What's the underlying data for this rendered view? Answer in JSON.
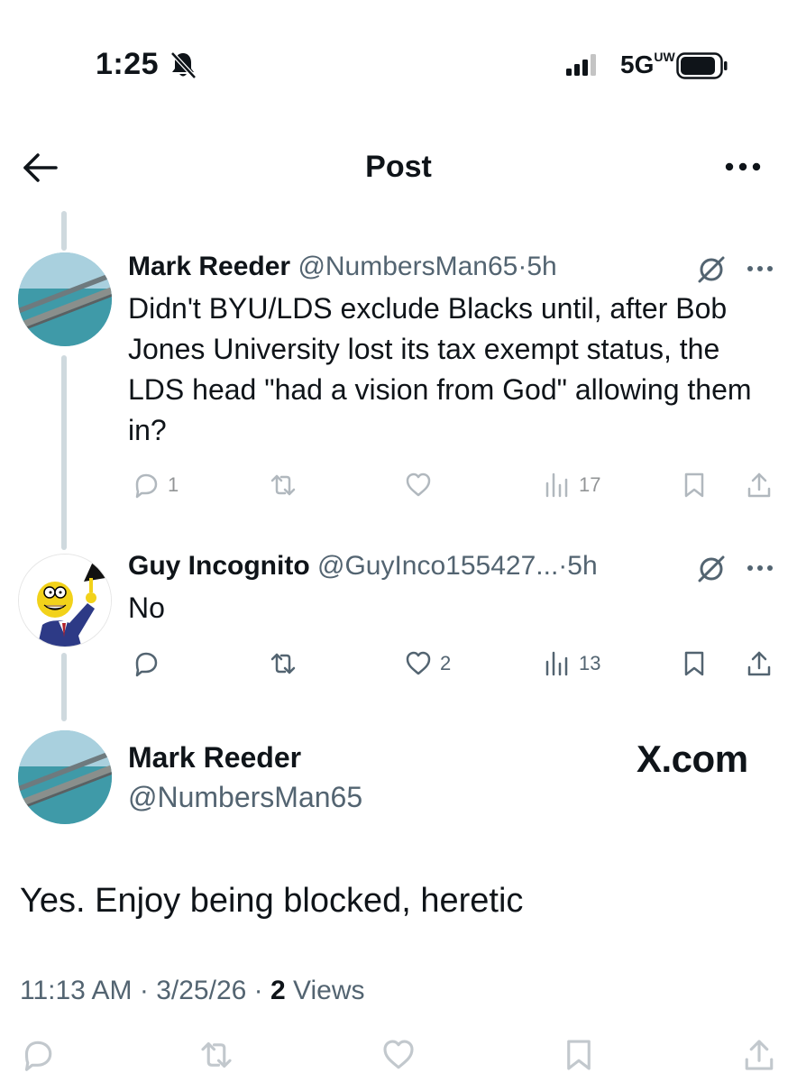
{
  "status_bar": {
    "time": "1:25",
    "network": "5G",
    "network_sup": "UW"
  },
  "nav": {
    "title": "Post"
  },
  "thread": [
    {
      "name": "Mark Reeder",
      "handle": "@NumbersMan65",
      "separator": "·",
      "time": "5h",
      "text": "Didn't BYU/LDS exclude Blacks until, after Bob Jones University lost its tax exempt status, the LDS head \"had a vision from God\" allowing them in?",
      "replies": "1",
      "likes": "",
      "views": "17"
    },
    {
      "name": "Guy Incognito",
      "handle": "@GuyInco155427...",
      "separator": "·",
      "time": "5h",
      "text": "No",
      "replies": "",
      "likes": "2",
      "views": "13"
    }
  ],
  "main_post": {
    "name": "Mark Reeder",
    "handle": "@NumbersMan65",
    "watermark": "X.com",
    "text": "Yes.  Enjoy being blocked, heretic",
    "time": "11:13 AM",
    "sep1": "·",
    "date": "3/25/26",
    "sep2": "·",
    "views_count": "2",
    "views_label": "Views"
  },
  "icons": {
    "reply": "reply-icon",
    "retweet": "retweet-icon",
    "like": "heart-icon",
    "views": "views-icon",
    "bookmark": "bookmark-icon",
    "share": "share-icon"
  },
  "colors": {
    "text": "#0f1419",
    "secondary": "#536471",
    "thread_line": "#cfd9de"
  }
}
